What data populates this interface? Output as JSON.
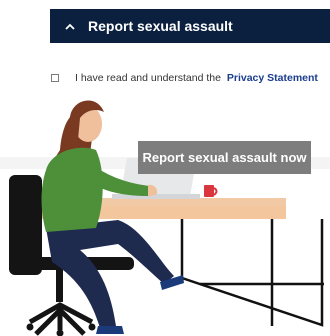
{
  "accordion": {
    "title": "Report sexual assault",
    "expanded": true,
    "chevron_icon": "chevron-up-icon",
    "background_color": "#0b1f3f"
  },
  "consent": {
    "checked": false,
    "text": "I have read and understand the",
    "link_label": "Privacy Statement",
    "link_color": "#1a3d8f"
  },
  "report_button": {
    "label": "Report sexual assault now",
    "background_color": "#7d7d7d"
  },
  "illustration": {
    "subject": "woman-working-at-laptop"
  }
}
